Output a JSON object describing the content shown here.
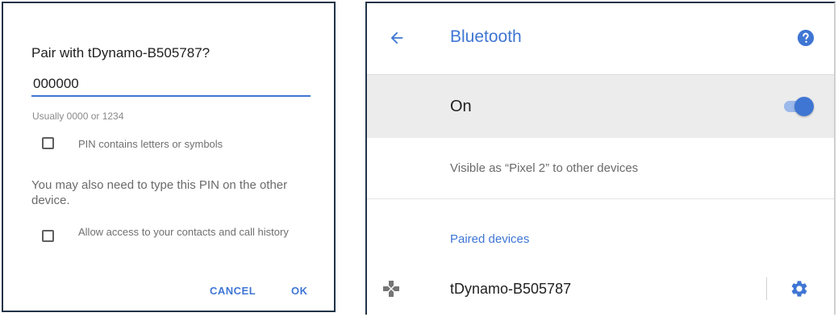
{
  "dialog": {
    "title": "Pair with tDynamo-B505787?",
    "pin_value": "000000",
    "pin_hint": "Usually 0000 or 1234",
    "pin_letters_checkbox_label": "PIN contains letters or symbols",
    "pin_letters_checked": false,
    "pin_note": "You may also need to type this PIN on the other device.",
    "contacts_checkbox_label": "Allow access to your contacts and call history",
    "contacts_checked": false,
    "cancel_label": "CANCEL",
    "ok_label": "OK"
  },
  "settings": {
    "title": "Bluetooth",
    "back_icon": "arrow-back-icon",
    "help_icon": "help-icon",
    "toggle_label": "On",
    "toggle_on": true,
    "visible_text": "Visible as “Pixel 2” to other devices",
    "paired_header": "Paired devices",
    "paired_devices": [
      {
        "name": "tDynamo-B505787",
        "icon": "gamepad-icon",
        "settings_icon": "gear-icon"
      }
    ]
  },
  "colors": {
    "accent": "#3f76d4",
    "toggle_track": "#9cb9eb",
    "row_highlight": "#ececec",
    "frame_border": "#1f3347"
  }
}
